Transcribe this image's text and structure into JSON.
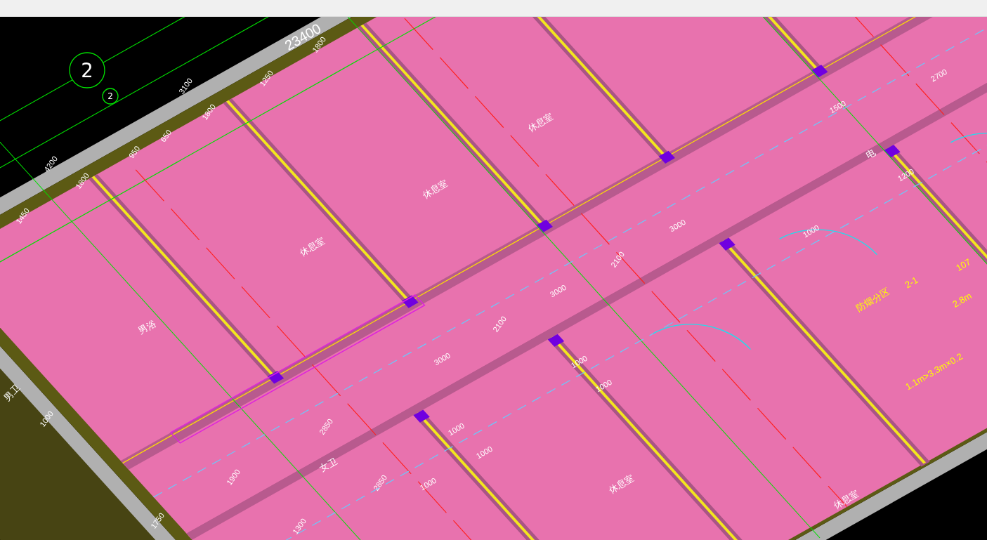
{
  "viewport": {
    "axis_bubbles": [
      {
        "label": "2",
        "kind": "large"
      },
      {
        "label": "2",
        "kind": "small"
      }
    ],
    "labels": [
      {
        "text": "23400",
        "kind": "overall"
      },
      {
        "text": "3100",
        "kind": "dimension"
      },
      {
        "text": "1800",
        "kind": "dimension"
      },
      {
        "text": "650",
        "kind": "dimension"
      },
      {
        "text": "950",
        "kind": "dimension"
      },
      {
        "text": "4200",
        "kind": "dimension"
      },
      {
        "text": "1800",
        "kind": "dimension"
      },
      {
        "text": "1450",
        "kind": "dimension"
      },
      {
        "text": "1250",
        "kind": "dimension"
      },
      {
        "text": "1800",
        "kind": "dimension"
      },
      {
        "text": "2100",
        "kind": "dimension"
      },
      {
        "text": "3000",
        "kind": "dimension"
      },
      {
        "text": "3000",
        "kind": "dimension"
      },
      {
        "text": "2100",
        "kind": "dimension"
      },
      {
        "text": "3000",
        "kind": "dimension"
      },
      {
        "text": "2850",
        "kind": "dimension"
      },
      {
        "text": "2850",
        "kind": "dimension"
      },
      {
        "text": "1000",
        "kind": "dimension"
      },
      {
        "text": "1500",
        "kind": "dimension"
      },
      {
        "text": "2700",
        "kind": "dimension"
      },
      {
        "text": "1200",
        "kind": "dimension"
      },
      {
        "text": "1000",
        "kind": "dimension"
      },
      {
        "text": "1000",
        "kind": "dimension"
      },
      {
        "text": "1000",
        "kind": "dimension"
      },
      {
        "text": "1000",
        "kind": "dimension"
      },
      {
        "text": "1000",
        "kind": "dimension"
      },
      {
        "text": "1000",
        "kind": "dimension"
      },
      {
        "text": "1750",
        "kind": "dimension"
      },
      {
        "text": "1900",
        "kind": "dimension"
      },
      {
        "text": "1300",
        "kind": "dimension"
      },
      {
        "text": "休息室",
        "kind": "room"
      },
      {
        "text": "休息室",
        "kind": "room"
      },
      {
        "text": "休息室",
        "kind": "room"
      },
      {
        "text": "休息室",
        "kind": "room"
      },
      {
        "text": "休息室",
        "kind": "room"
      },
      {
        "text": "男浴",
        "kind": "room"
      },
      {
        "text": "男卫",
        "kind": "room"
      },
      {
        "text": "女卫",
        "kind": "room"
      },
      {
        "text": "电",
        "kind": "room"
      },
      {
        "text": "2-1",
        "kind": "note"
      },
      {
        "text": "107",
        "kind": "note"
      },
      {
        "text": "2.8m",
        "kind": "note"
      },
      {
        "text": "防烟分区",
        "kind": "note"
      },
      {
        "text": "1.1m>3.3m×0.2",
        "kind": "note"
      }
    ]
  }
}
